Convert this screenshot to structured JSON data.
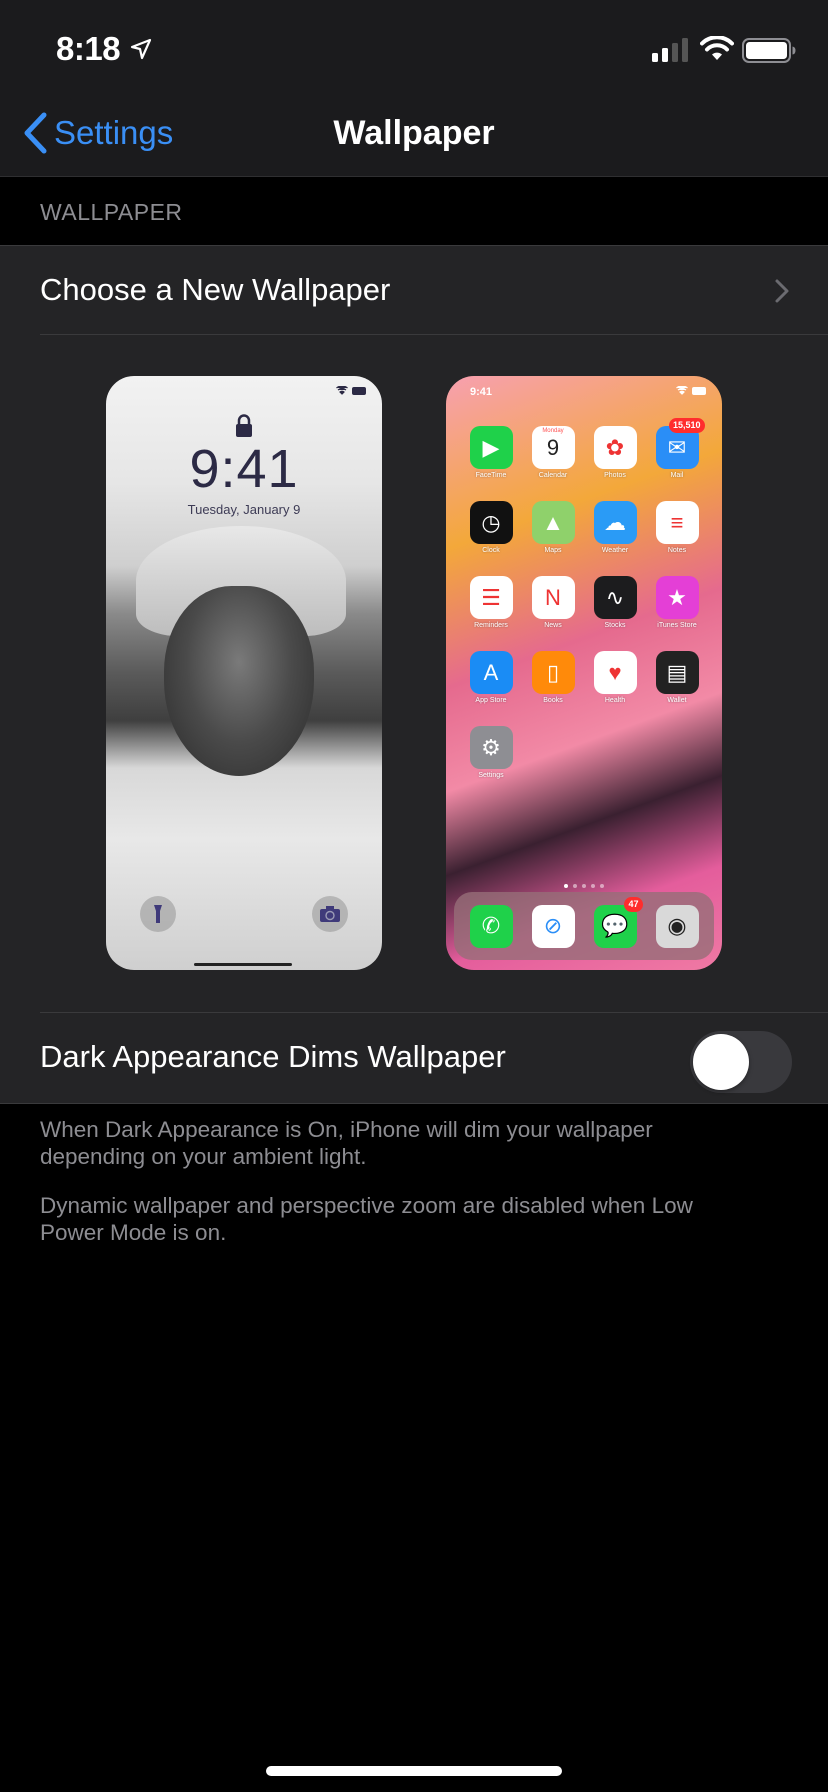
{
  "status_bar": {
    "time": "8:18",
    "location_icon": "location-arrow-icon",
    "signal_icon": "cellular-signal-icon",
    "wifi_icon": "wifi-icon",
    "battery_icon": "battery-icon"
  },
  "nav": {
    "back_label": "Settings",
    "title": "Wallpaper"
  },
  "section": {
    "header": "WALLPAPER"
  },
  "rows": {
    "choose_label": "Choose a New Wallpaper",
    "dims_label": "Dark Appearance Dims Wallpaper",
    "dims_enabled": false
  },
  "lock_preview": {
    "time": "9:41",
    "date": "Tuesday, January 9",
    "left_button": "flashlight-icon",
    "right_button": "camera-icon"
  },
  "home_preview": {
    "time": "9:41",
    "apps": [
      {
        "label": "FaceTime",
        "color": "#1fd14a",
        "glyph": "▶",
        "badge": ""
      },
      {
        "label": "Calendar",
        "color": "#ffffff",
        "glyph": "9",
        "badge": "",
        "sub": "Monday"
      },
      {
        "label": "Photos",
        "color": "#ffffff",
        "glyph": "✿",
        "badge": ""
      },
      {
        "label": "Mail",
        "color": "#2a8ef7",
        "glyph": "✉",
        "badge": "15,510"
      },
      {
        "label": "Clock",
        "color": "#111111",
        "glyph": "◷",
        "badge": ""
      },
      {
        "label": "Maps",
        "color": "#8fd16b",
        "glyph": "▲",
        "badge": ""
      },
      {
        "label": "Weather",
        "color": "#2a9bf6",
        "glyph": "☁",
        "badge": ""
      },
      {
        "label": "Notes",
        "color": "#ffffff",
        "glyph": "≡",
        "badge": ""
      },
      {
        "label": "Reminders",
        "color": "#ffffff",
        "glyph": "☰",
        "badge": ""
      },
      {
        "label": "News",
        "color": "#ffffff",
        "glyph": "N",
        "badge": ""
      },
      {
        "label": "Stocks",
        "color": "#1c1c1e",
        "glyph": "∿",
        "badge": ""
      },
      {
        "label": "iTunes Store",
        "color": "#e43fd6",
        "glyph": "★",
        "badge": ""
      },
      {
        "label": "App Store",
        "color": "#1a8cf5",
        "glyph": "A",
        "badge": ""
      },
      {
        "label": "Books",
        "color": "#ff8a0a",
        "glyph": "▯",
        "badge": ""
      },
      {
        "label": "Health",
        "color": "#ffffff",
        "glyph": "♥",
        "badge": ""
      },
      {
        "label": "Wallet",
        "color": "#222222",
        "glyph": "▤",
        "badge": ""
      },
      {
        "label": "Settings",
        "color": "#8e8e93",
        "glyph": "⚙",
        "badge": ""
      }
    ],
    "page_dots": 5,
    "active_page": 1,
    "dock": [
      {
        "name": "Phone",
        "color": "#1fd14a",
        "glyph": "✆",
        "badge": ""
      },
      {
        "name": "Safari",
        "color": "#ffffff",
        "glyph": "⊘",
        "badge": ""
      },
      {
        "name": "Messages",
        "color": "#1fd14a",
        "glyph": "💬",
        "badge": "47"
      },
      {
        "name": "Camera",
        "color": "#d9d9d9",
        "glyph": "◉",
        "badge": ""
      }
    ]
  },
  "footer": {
    "note_1": "When Dark Appearance is On, iPhone will dim your wallpaper depending on your ambient light.",
    "note_2": "Dynamic wallpaper and perspective zoom are disabled when Low Power Mode is on."
  },
  "colors": {
    "accent": "#3a8ff5",
    "background": "#000000",
    "cell": "#242426",
    "secondary_text": "#8d8d92"
  }
}
